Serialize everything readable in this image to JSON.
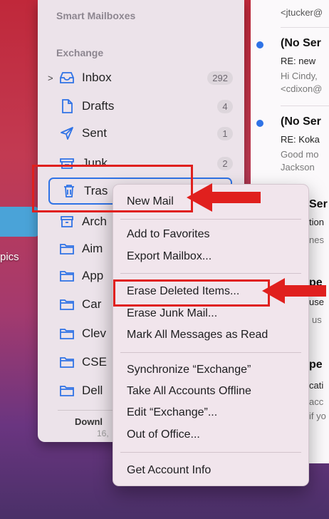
{
  "desktop": {
    "label": "pics"
  },
  "sidebar": {
    "smart_mailboxes": "Smart Mailboxes",
    "exchange": "Exchange",
    "items": [
      {
        "label": "Inbox",
        "count": "292",
        "icon": "tray-icon"
      },
      {
        "label": "Drafts",
        "count": "4",
        "icon": "document-icon"
      },
      {
        "label": "Sent",
        "count": "1",
        "icon": "paper-plane-icon"
      },
      {
        "label": "Junk",
        "count": "2",
        "icon": "junk-tray-icon"
      },
      {
        "label": "Tras",
        "icon": "trash-icon"
      },
      {
        "label": "Arch",
        "icon": "archive-box-icon"
      },
      {
        "label": "Aim",
        "icon": "folder-icon"
      },
      {
        "label": "App",
        "icon": "folder-icon"
      },
      {
        "label": "Car",
        "icon": "folder-icon"
      },
      {
        "label": "Clev",
        "icon": "folder-icon"
      },
      {
        "label": "CSE",
        "icon": "folder-icon"
      },
      {
        "label": "Dell",
        "icon": "folder-icon"
      }
    ],
    "footer_title": "Downl",
    "footer_sub": "16,"
  },
  "messages": {
    "top_preview": "<jtucker@",
    "m1": {
      "from": "(No Ser",
      "subject": "RE: new",
      "preview1": "Hi Cindy,",
      "preview2": "<cdixon@"
    },
    "m2": {
      "from": "(No Ser",
      "subject": "RE: Koka",
      "preview1": "Good mo",
      "preview2": "Jackson"
    },
    "m3": {
      "from": "Ser",
      "line1": "tion",
      "line2": "nes"
    },
    "m4": {
      "from": "pe",
      "line1": "use",
      "line2": "us"
    },
    "m5": {
      "from": "pe",
      "line1": "cati",
      "line2": "acc",
      "line3": "if yo"
    }
  },
  "context_menu": {
    "new_mailbox": "New Mail",
    "add_to_favorites": "Add to Favorites",
    "export_mailbox": "Export Mailbox...",
    "erase_deleted": "Erase Deleted Items...",
    "erase_junk": "Erase Junk Mail...",
    "mark_all_read": "Mark All Messages as Read",
    "synchronize": "Synchronize “Exchange”",
    "take_offline": "Take All Accounts Offline",
    "edit_account": "Edit “Exchange”...",
    "out_of_office": "Out of Office...",
    "get_account_info": "Get Account Info"
  },
  "colors": {
    "accent": "#2f73e6",
    "annotation": "#e0201e"
  }
}
